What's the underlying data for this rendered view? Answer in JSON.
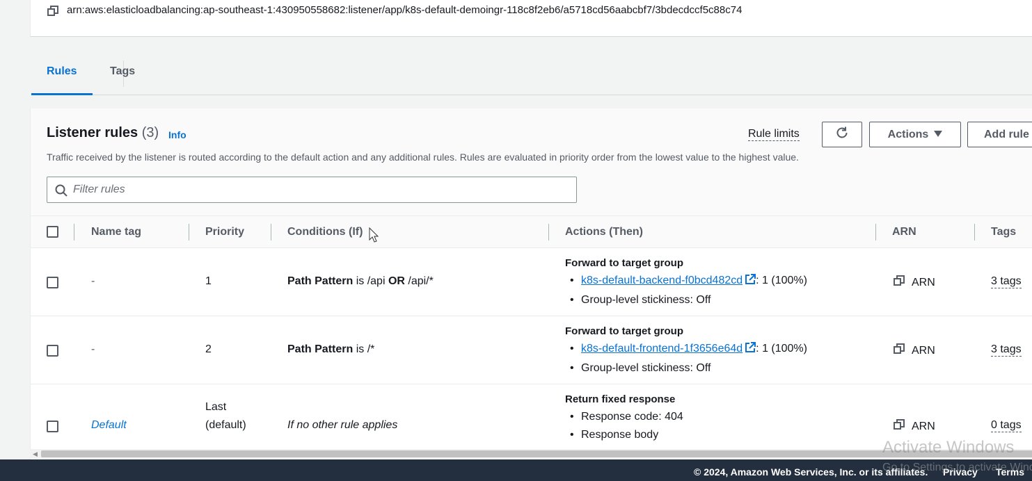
{
  "arn_panel": {
    "arn_value": "arn:aws:elasticloadbalancing:ap-southeast-1:430950558682:listener/app/k8s-default-demoingr-118c8f2eb6/a5718cd56aabcbf7/3bdecdccf5c88c74"
  },
  "tabs": [
    {
      "label": "Rules",
      "active": true
    },
    {
      "label": "Tags",
      "active": false
    }
  ],
  "listener_rules": {
    "title": "Listener rules",
    "count": "(3)",
    "info_label": "Info",
    "description": "Traffic received by the listener is routed according to the default action and any additional rules. Rules are evaluated in priority order from the lowest value to the highest value.",
    "rule_limits_label": "Rule limits",
    "actions_label": "Actions",
    "add_rule_label": "Add rule",
    "filter_placeholder": "Filter rules"
  },
  "table": {
    "columns": [
      "Name tag",
      "Priority",
      "Conditions (If)",
      "Actions (Then)",
      "ARN",
      "Tags"
    ],
    "rows": [
      {
        "name_tag": "-",
        "priority": "1",
        "condition_field": "Path Pattern",
        "condition_op": " is /api ",
        "condition_or": "OR",
        "condition_rest": " /api/*",
        "action_title": "Forward to target group",
        "target_group_link": "k8s-default-backend-f0bcd482cd",
        "target_weight": ": 1 (100%)",
        "stickiness": "Group-level stickiness: Off",
        "arn_label": "ARN",
        "tags_label": "3 tags"
      },
      {
        "name_tag": "-",
        "priority": "2",
        "condition_field": "Path Pattern",
        "condition_op": " is /*",
        "action_title": "Forward to target group",
        "target_group_link": "k8s-default-frontend-1f3656e64d",
        "target_weight": ": 1 (100%)",
        "stickiness": "Group-level stickiness: Off",
        "arn_label": "ARN",
        "tags_label": "3 tags"
      },
      {
        "name_tag": "Default",
        "priority_line1": "Last",
        "priority_line2": "(default)",
        "condition_text": "If no other rule applies",
        "action_title": "Return fixed response",
        "response_code": "Response code: 404",
        "response_body": "Response body",
        "arn_label": "ARN",
        "tags_label": "0 tags"
      }
    ]
  },
  "footer": {
    "copyright": "© 2024, Amazon Web Services, Inc. or its affiliates.",
    "privacy": "Privacy",
    "terms": "Terms"
  },
  "watermark": {
    "line1": "Activate Windows",
    "line2": "Go to Settings to activate Windows."
  },
  "colors": {
    "link": "#0972d3",
    "footer_bg": "#232f3e",
    "page_bg": "#f2f3f3"
  }
}
